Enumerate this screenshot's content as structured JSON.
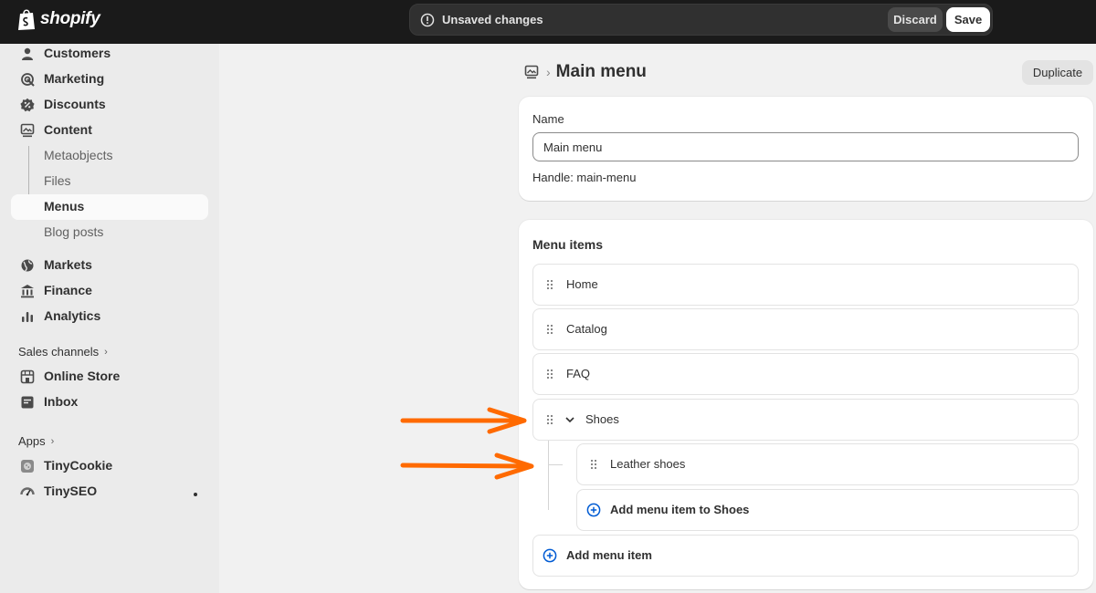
{
  "topbar": {
    "brand": "shopify",
    "unsaved_text": "Unsaved changes",
    "discard_label": "Discard",
    "save_label": "Save"
  },
  "sidebar": {
    "items": [
      {
        "label": "Customers",
        "icon": "person-icon"
      },
      {
        "label": "Marketing",
        "icon": "target-icon"
      },
      {
        "label": "Discounts",
        "icon": "discount-icon"
      },
      {
        "label": "Content",
        "icon": "content-icon"
      },
      {
        "label": "Metaobjects"
      },
      {
        "label": "Files"
      },
      {
        "label": "Menus",
        "active": true
      },
      {
        "label": "Blog posts"
      },
      {
        "label": "Markets",
        "icon": "globe-icon"
      },
      {
        "label": "Finance",
        "icon": "bank-icon"
      },
      {
        "label": "Analytics",
        "icon": "bar-chart-icon"
      }
    ],
    "sales_channels_heading": "Sales channels",
    "sales_channels": [
      {
        "label": "Online Store",
        "icon": "store-icon"
      },
      {
        "label": "Inbox",
        "icon": "inbox-icon"
      }
    ],
    "apps_heading": "Apps",
    "apps": [
      {
        "label": "TinyCookie",
        "icon": "cookie-app-icon"
      },
      {
        "label": "TinySEO",
        "icon": "seo-app-icon"
      }
    ]
  },
  "main": {
    "page_title": "Main menu",
    "duplicate_label": "Duplicate",
    "name_card": {
      "name_label": "Name",
      "name_value": "Main menu",
      "handle_text": "Handle: main-menu"
    },
    "menu_items_card": {
      "heading": "Menu items",
      "items": [
        {
          "label": "Home"
        },
        {
          "label": "Catalog"
        },
        {
          "label": "FAQ"
        },
        {
          "label": "Shoes",
          "expanded": true
        }
      ],
      "child_items": [
        {
          "label": "Leather shoes"
        }
      ],
      "add_child_label": "Add menu item to Shoes",
      "add_item_label": "Add menu item"
    }
  },
  "colors": {
    "annotation_arrow": "#ff6a00",
    "link_blue": "#005bd3",
    "topbar_bg": "#1a1a1a"
  }
}
